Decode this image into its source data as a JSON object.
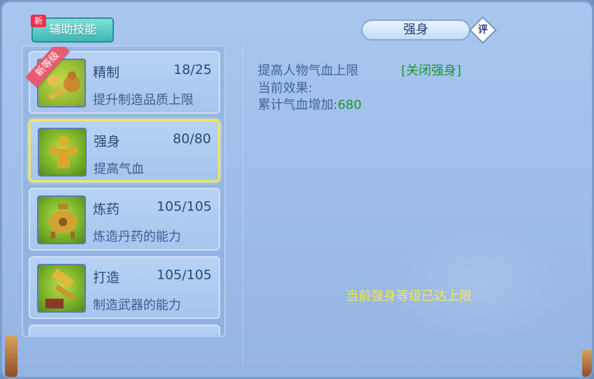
{
  "category_tab": {
    "label": "辅助技能",
    "new_tag": "新"
  },
  "skills": [
    {
      "name": "精制",
      "level": "18/25",
      "desc": "提升制造品质上限",
      "ribbon": "新等级",
      "icon": "gourd-tools-icon"
    },
    {
      "name": "强身",
      "level": "80/80",
      "desc": "提高气血",
      "icon": "muscle-man-icon"
    },
    {
      "name": "炼药",
      "level": "105/105",
      "desc": "炼造丹药的能力",
      "icon": "cauldron-icon"
    },
    {
      "name": "打造",
      "level": "105/105",
      "desc": "制造武器的能力",
      "icon": "hammer-anvil-icon"
    }
  ],
  "detail": {
    "title": "强身",
    "rate_label": "评",
    "line1": "提高人物气血上限",
    "toggle_label": "[关闭强身]",
    "line2": "当前效果:",
    "line3_label": "累计气血增加:",
    "line3_value": "680",
    "max_notice": "当前强身等级已达上限"
  },
  "colors": {
    "accent_green": "#1b9a2b",
    "notice_yellow": "#f3e74a",
    "selected_border": "#f0e46a"
  }
}
